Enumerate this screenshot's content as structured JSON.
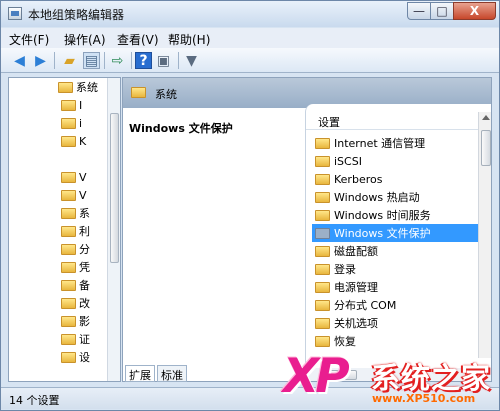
{
  "window": {
    "title": "本地组策略编辑器"
  },
  "controls": {
    "minimize": "—",
    "maximize": "□",
    "close": "X"
  },
  "menu": [
    "文件(F)",
    "操作(A)",
    "查看(V)",
    "帮助(H)"
  ],
  "toolbar": {
    "icons": [
      "back-icon",
      "forward-icon",
      "up-folder-icon",
      "show-hide-tree-icon",
      "export-list-icon",
      "help-icon",
      "properties-icon",
      "filter-icon"
    ]
  },
  "tree": {
    "items": [
      "系统",
      "I",
      "i",
      "K",
      "V",
      "V",
      "系",
      "利",
      "分",
      "凭",
      "备",
      "改",
      "影",
      "证",
      "设"
    ]
  },
  "path": {
    "label": "系统"
  },
  "description": {
    "title": "Windows 文件保护"
  },
  "list": {
    "header": "设置",
    "items": [
      {
        "label": "Internet 通信管理"
      },
      {
        "label": "iSCSI"
      },
      {
        "label": "Kerberos"
      },
      {
        "label": "Windows 热启动"
      },
      {
        "label": "Windows 时间服务"
      },
      {
        "label": "Windows 文件保护",
        "selected": true
      },
      {
        "label": "磁盘配额"
      },
      {
        "label": "登录"
      },
      {
        "label": "电源管理"
      },
      {
        "label": "分布式 COM"
      },
      {
        "label": "关机选项"
      },
      {
        "label": "恢复"
      }
    ]
  },
  "tabs": [
    "扩展",
    "标准"
  ],
  "status": {
    "text": "14 个设置"
  },
  "watermark": {
    "logo": "XP",
    "brand": "系统之家",
    "url": "www.XP510.com"
  },
  "colors": {
    "selected": "#3399ff",
    "window_frame": "#d7e4f2",
    "logo_pink": "#e91e8f",
    "logo_red": "#e32020"
  }
}
